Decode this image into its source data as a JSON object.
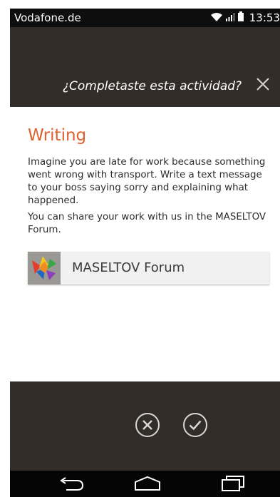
{
  "status_bar": {
    "carrier": "Vodafone.de",
    "time": "13:53",
    "icons": [
      "wifi-icon",
      "signal-icon",
      "battery-icon"
    ]
  },
  "header": {
    "title": "¿Completaste esta actividad?",
    "close_icon": "close-icon"
  },
  "content": {
    "title": "Writing",
    "description": "Imagine you are late for work because something went wrong with transport. Write a text message to your boss saying sorry and explaining what happened.",
    "share_text": "You can share your work with us in the MASELTOV Forum.",
    "forum_link": {
      "label": "MASELTOV Forum",
      "icon": "maseltov-logo"
    }
  },
  "actions": {
    "cancel_icon": "cancel-icon",
    "confirm_icon": "check-icon"
  },
  "nav_bar": {
    "icons": [
      "back-icon",
      "home-icon",
      "recent-apps-icon"
    ]
  },
  "colors": {
    "accent": "#e0602f",
    "header_bg": "#322d29",
    "panel_bg": "#322d29",
    "status_bg": "#0e0e0e",
    "nav_bg": "#050505"
  }
}
